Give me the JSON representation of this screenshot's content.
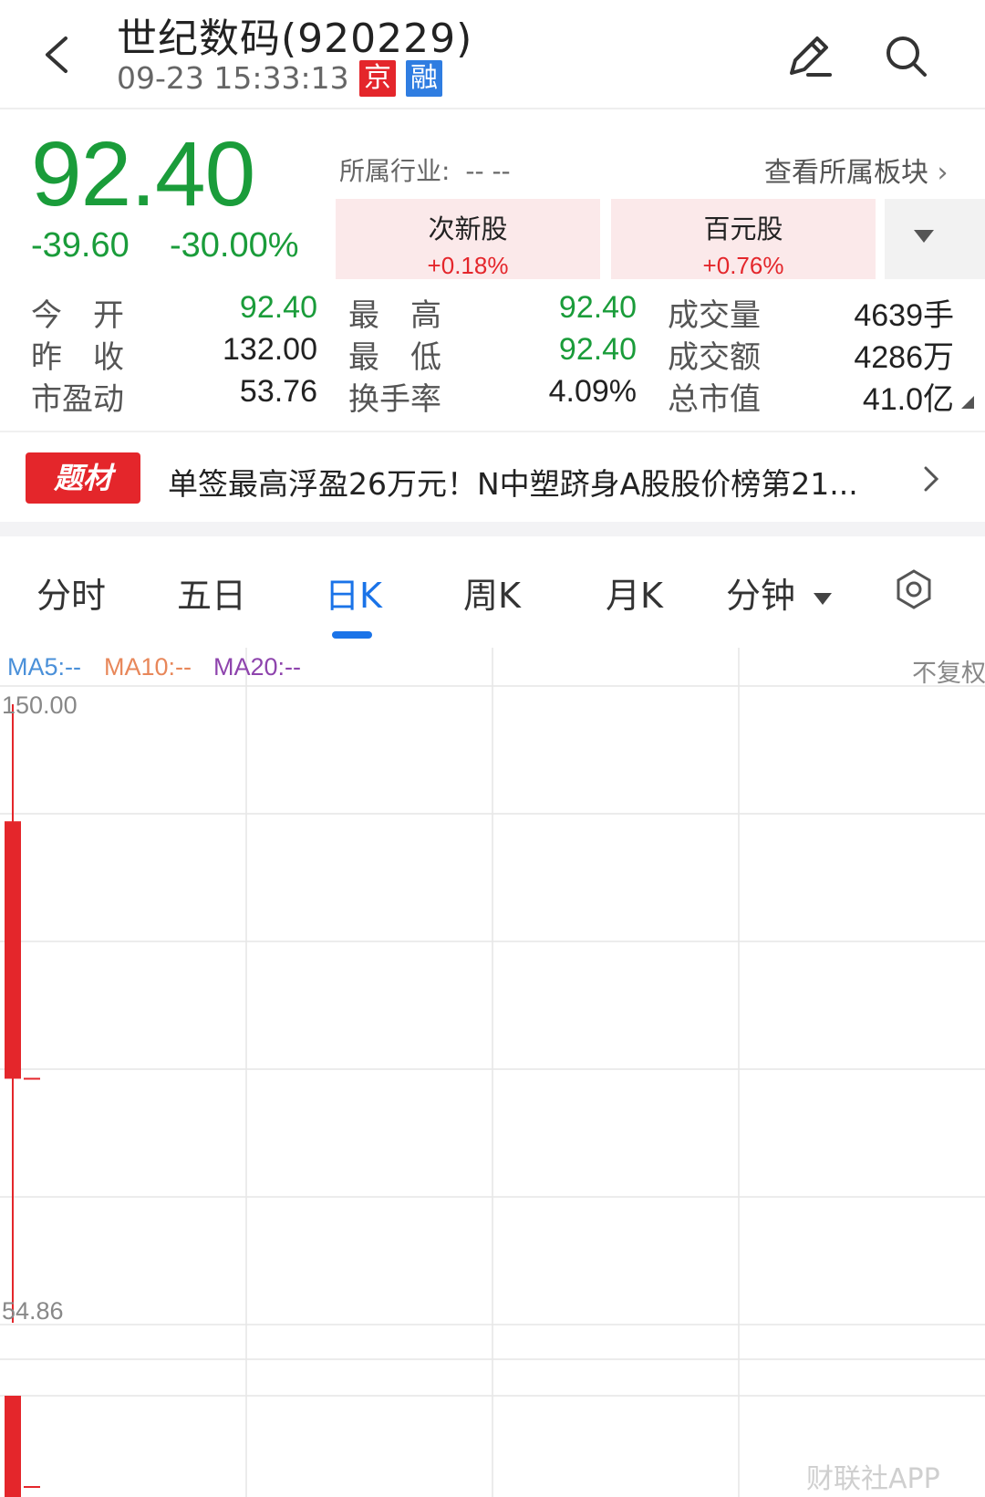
{
  "header": {
    "title": "世纪数码(920229)",
    "datetime": "09-23 15:33:13",
    "tag_exchange": "京",
    "tag_margin": "融"
  },
  "quote": {
    "price": "92.40",
    "change": "-39.60",
    "change_pct": "-30.00%",
    "industry_label": "所属行业:",
    "industry_value": "-- --",
    "board_link": "查看所属板块",
    "sectors": [
      {
        "name": "次新股",
        "change": "+0.18%"
      },
      {
        "name": "百元股",
        "change": "+0.76%"
      }
    ],
    "stats": [
      {
        "label": "今　开",
        "value": "92.40"
      },
      {
        "label": "昨　收",
        "value": "132.00"
      },
      {
        "label": "市盈动",
        "value": "53.76"
      },
      {
        "label": "最　高",
        "value": "92.40"
      },
      {
        "label": "最　低",
        "value": "92.40"
      },
      {
        "label": "换手率",
        "value": "4.09%"
      },
      {
        "label": "成交量",
        "value": "4639手"
      },
      {
        "label": "成交额",
        "value": "4286万"
      },
      {
        "label": "总市值",
        "value": "41.0亿"
      }
    ]
  },
  "news": {
    "badge": "题材",
    "text": "单签最高浮盈26万元！N中塑跻身A股股价榜第21..."
  },
  "tabs": [
    "分时",
    "五日",
    "日K",
    "周K",
    "月K",
    "分钟"
  ],
  "active_tab": "日K",
  "chart": {
    "ma5": "MA5:--",
    "ma10": "MA10:--",
    "ma20": "MA20:--",
    "adjust": "不复权",
    "y_top": "150.00",
    "y_bottom": "54.86"
  },
  "chart_data": {
    "type": "candlestick",
    "candles": [
      {
        "open": 132.0,
        "high": 150.0,
        "low": 54.86,
        "close": 92.4,
        "mark": 92.4
      }
    ],
    "ylim": [
      54.86,
      150.0
    ],
    "volume_bars": 1
  },
  "colors": {
    "up": "#e4262b",
    "down": "#1a9c3a",
    "accent": "#1a73e8",
    "ma5": "#4a90d9",
    "ma10": "#e8875a",
    "ma20": "#8e44ad"
  },
  "watermark": "财联社APP"
}
